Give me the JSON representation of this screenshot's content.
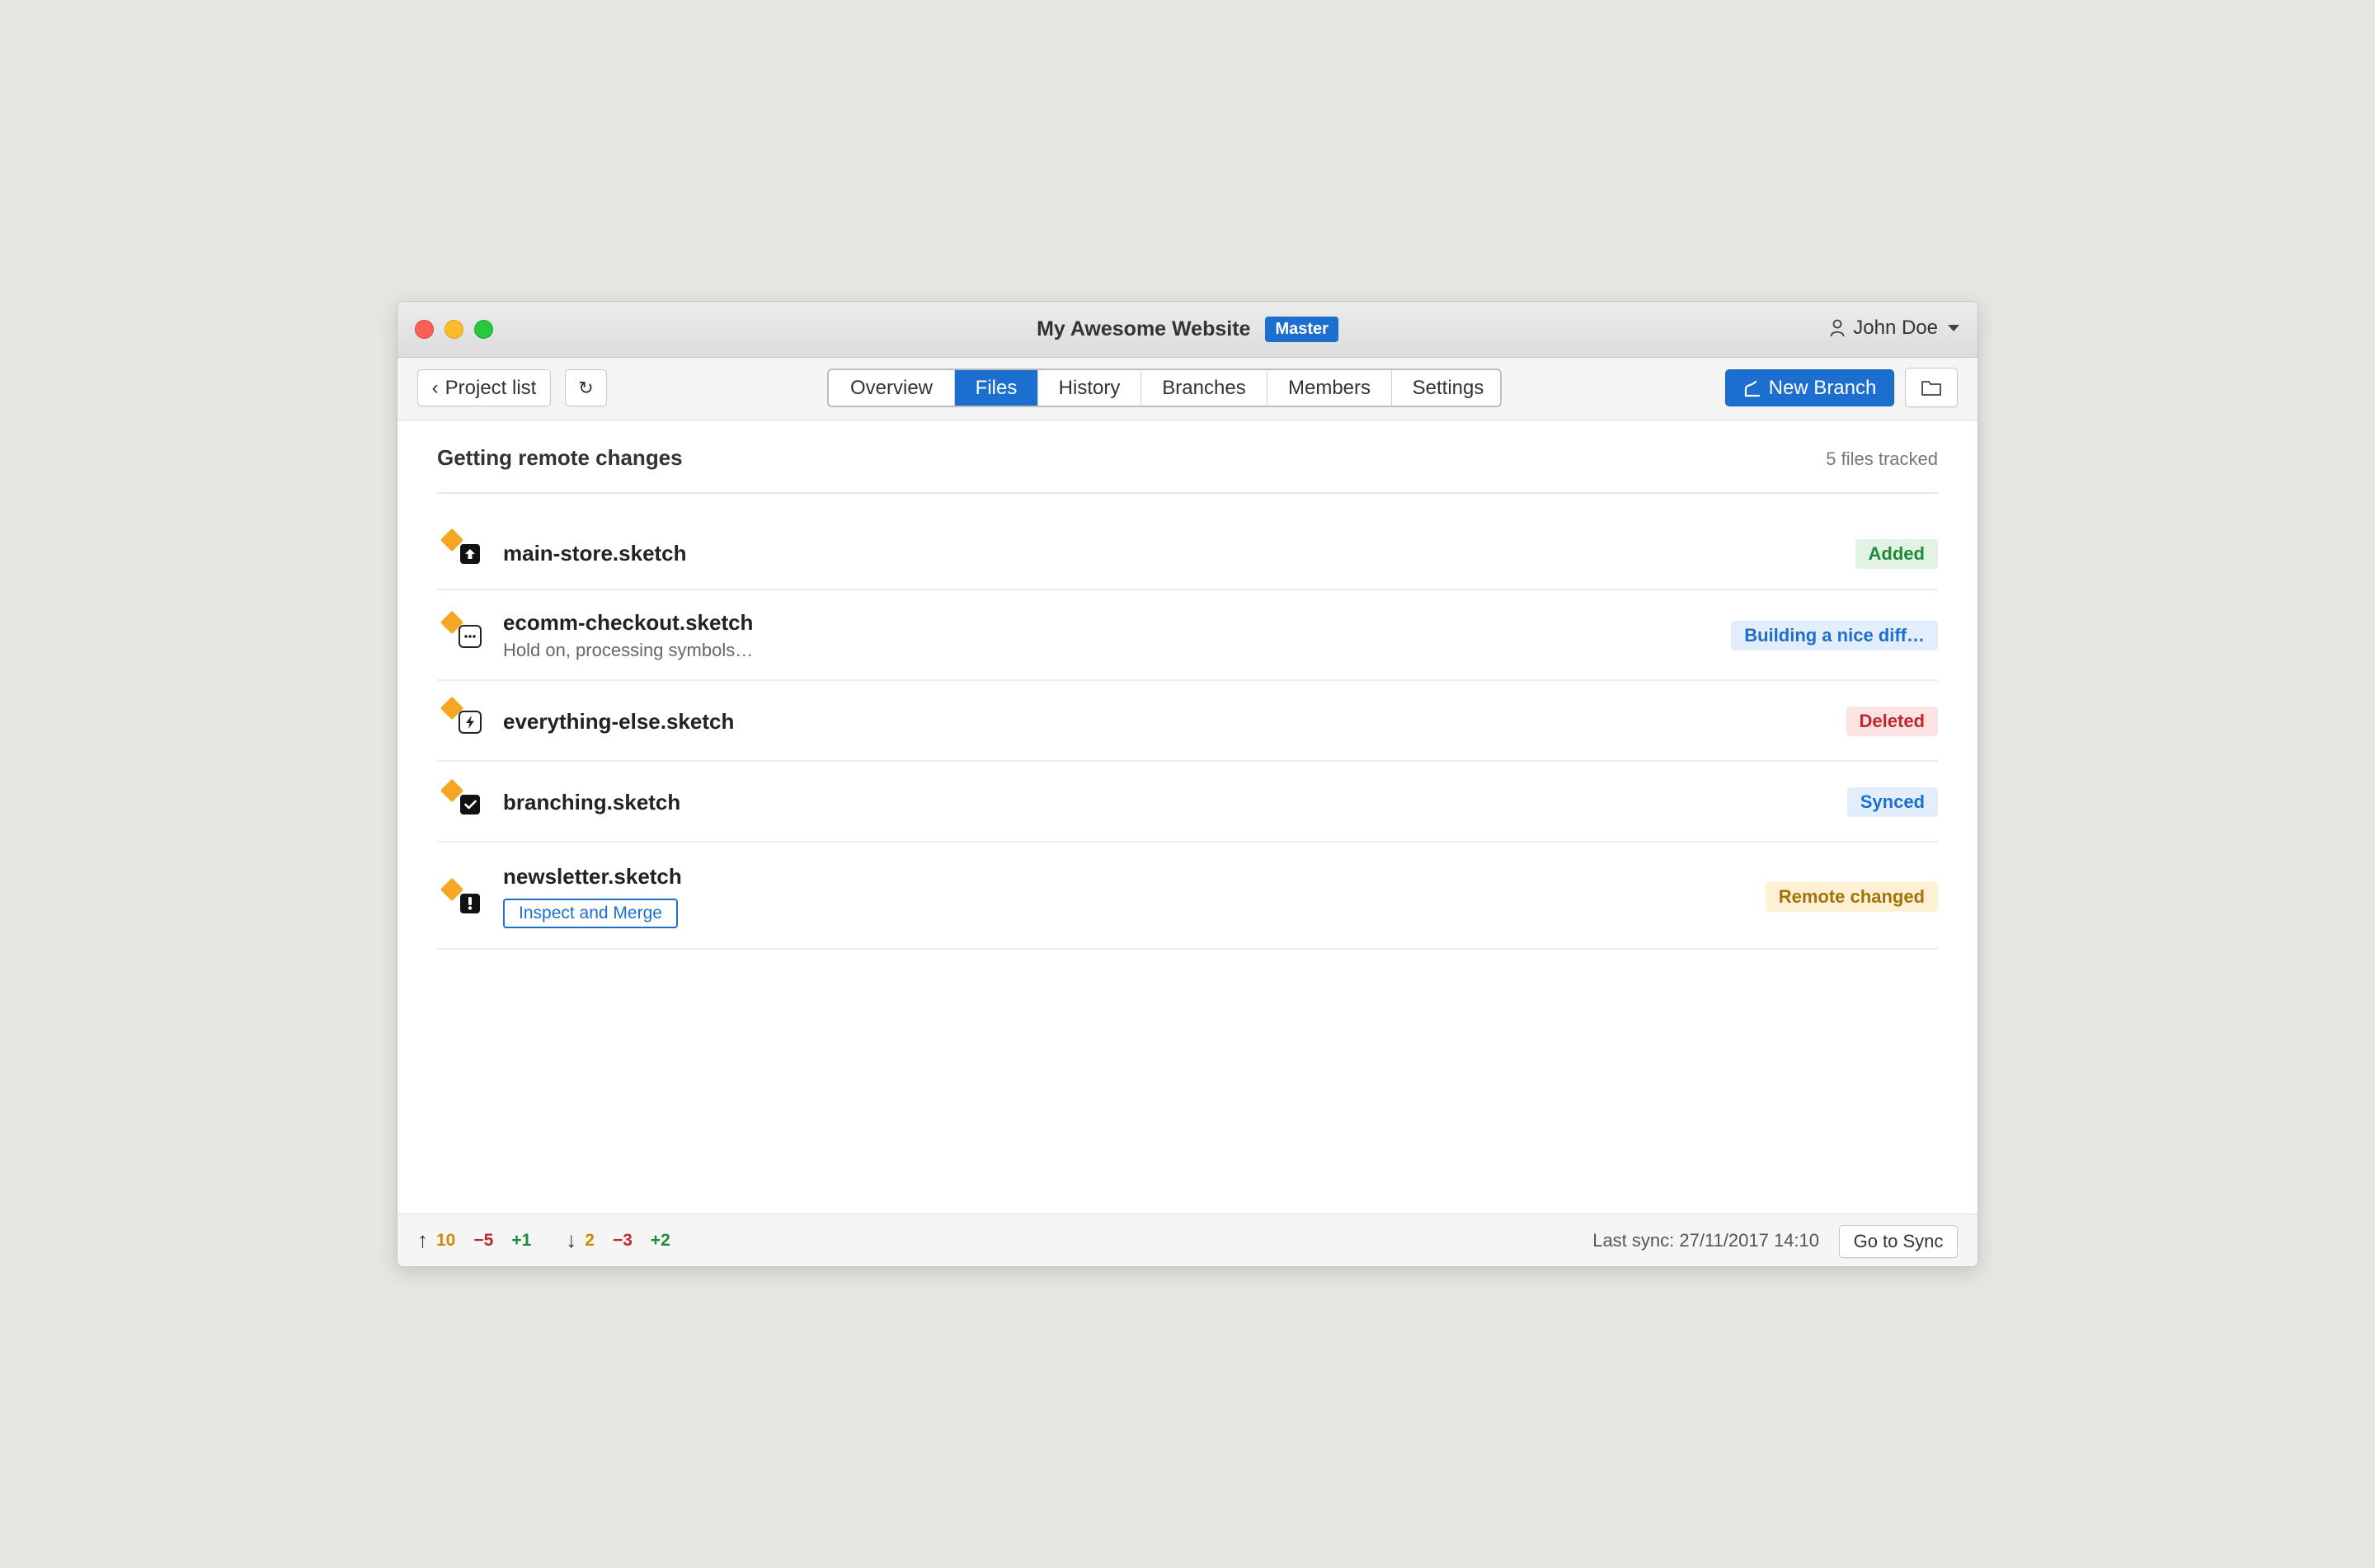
{
  "window": {
    "title": "My Awesome Website",
    "branch_badge": "Master",
    "user_name": "John Doe"
  },
  "toolbar": {
    "project_list_label": "Project list",
    "back_glyph": "‹",
    "refresh_glyph": "↻",
    "tabs": [
      {
        "label": "Overview",
        "active": false
      },
      {
        "label": "Files",
        "active": true
      },
      {
        "label": "History",
        "active": false
      },
      {
        "label": "Branches",
        "active": false
      },
      {
        "label": "Members",
        "active": false
      },
      {
        "label": "Settings",
        "active": false
      }
    ],
    "new_branch_label": "New Branch",
    "new_branch_icon": "branch-icon",
    "folder_icon": "folder-icon"
  },
  "content": {
    "section_title": "Getting remote changes",
    "files_count": "5 files tracked",
    "files": [
      {
        "name": "main-store.sketch",
        "status": "Added",
        "status_type": "added",
        "badge_icon": "upload-icon"
      },
      {
        "name": "ecomm-checkout.sketch",
        "subtitle": "Hold on, processing symbols…",
        "status": "Building a nice diff…",
        "status_type": "building",
        "badge_icon": "more-icon"
      },
      {
        "name": "everything-else.sketch",
        "status": "Deleted",
        "status_type": "deleted",
        "badge_icon": "lightning-icon"
      },
      {
        "name": "branching.sketch",
        "status": "Synced",
        "status_type": "synced",
        "badge_icon": "check-icon"
      },
      {
        "name": "newsletter.sketch",
        "action_label": "Inspect and Merge",
        "status": "Remote changed",
        "status_type": "remote",
        "badge_icon": "exclamation-icon"
      }
    ]
  },
  "footer": {
    "up_arrow": "↑",
    "up_changed": "10",
    "up_removed": "−5",
    "up_added": "+1",
    "down_arrow": "↓",
    "down_changed": "2",
    "down_removed": "−3",
    "down_added": "+2",
    "last_sync": "Last sync: 27/11/2017 14:10",
    "go_to_sync_label": "Go to Sync"
  },
  "colors": {
    "accent": "#1d6fcf",
    "sketch_diamond": "#f5a623",
    "added": "#1f8a3a",
    "deleted": "#c0282d",
    "remote": "#a4720b"
  }
}
